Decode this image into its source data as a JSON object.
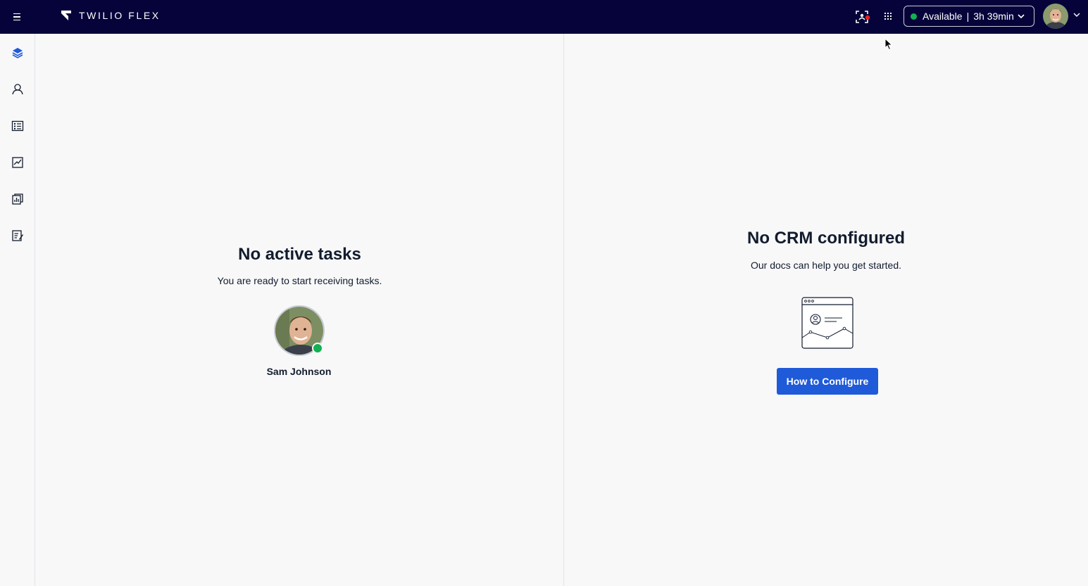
{
  "app": {
    "brand": "TWILIO FLEX"
  },
  "topbar": {
    "menu_icon": "hamburger-icon",
    "screen_record_icon": "screen-record-icon",
    "apps_icon": "grid-dots-icon",
    "status": {
      "label": "Available",
      "separator": "|",
      "duration": "3h 39min",
      "color": "#14b053"
    }
  },
  "sidenav": {
    "items": [
      {
        "name": "agent-desktop",
        "icon": "layers-icon",
        "active": true
      },
      {
        "name": "teams",
        "icon": "user-icon"
      },
      {
        "name": "queues",
        "icon": "list-card-icon"
      },
      {
        "name": "insights",
        "icon": "chart-icon"
      },
      {
        "name": "reports",
        "icon": "report-icon"
      },
      {
        "name": "quality",
        "icon": "edit-list-icon"
      }
    ]
  },
  "tasks_panel": {
    "title": "No active tasks",
    "subtitle": "You are ready to start receiving tasks.",
    "agent_name": "Sam Johnson",
    "agent_status_color": "#14b053"
  },
  "crm_panel": {
    "title": "No CRM configured",
    "subtitle": "Our docs can help you get started.",
    "button_label": "How to Configure",
    "button_color": "#1f5ad8"
  }
}
